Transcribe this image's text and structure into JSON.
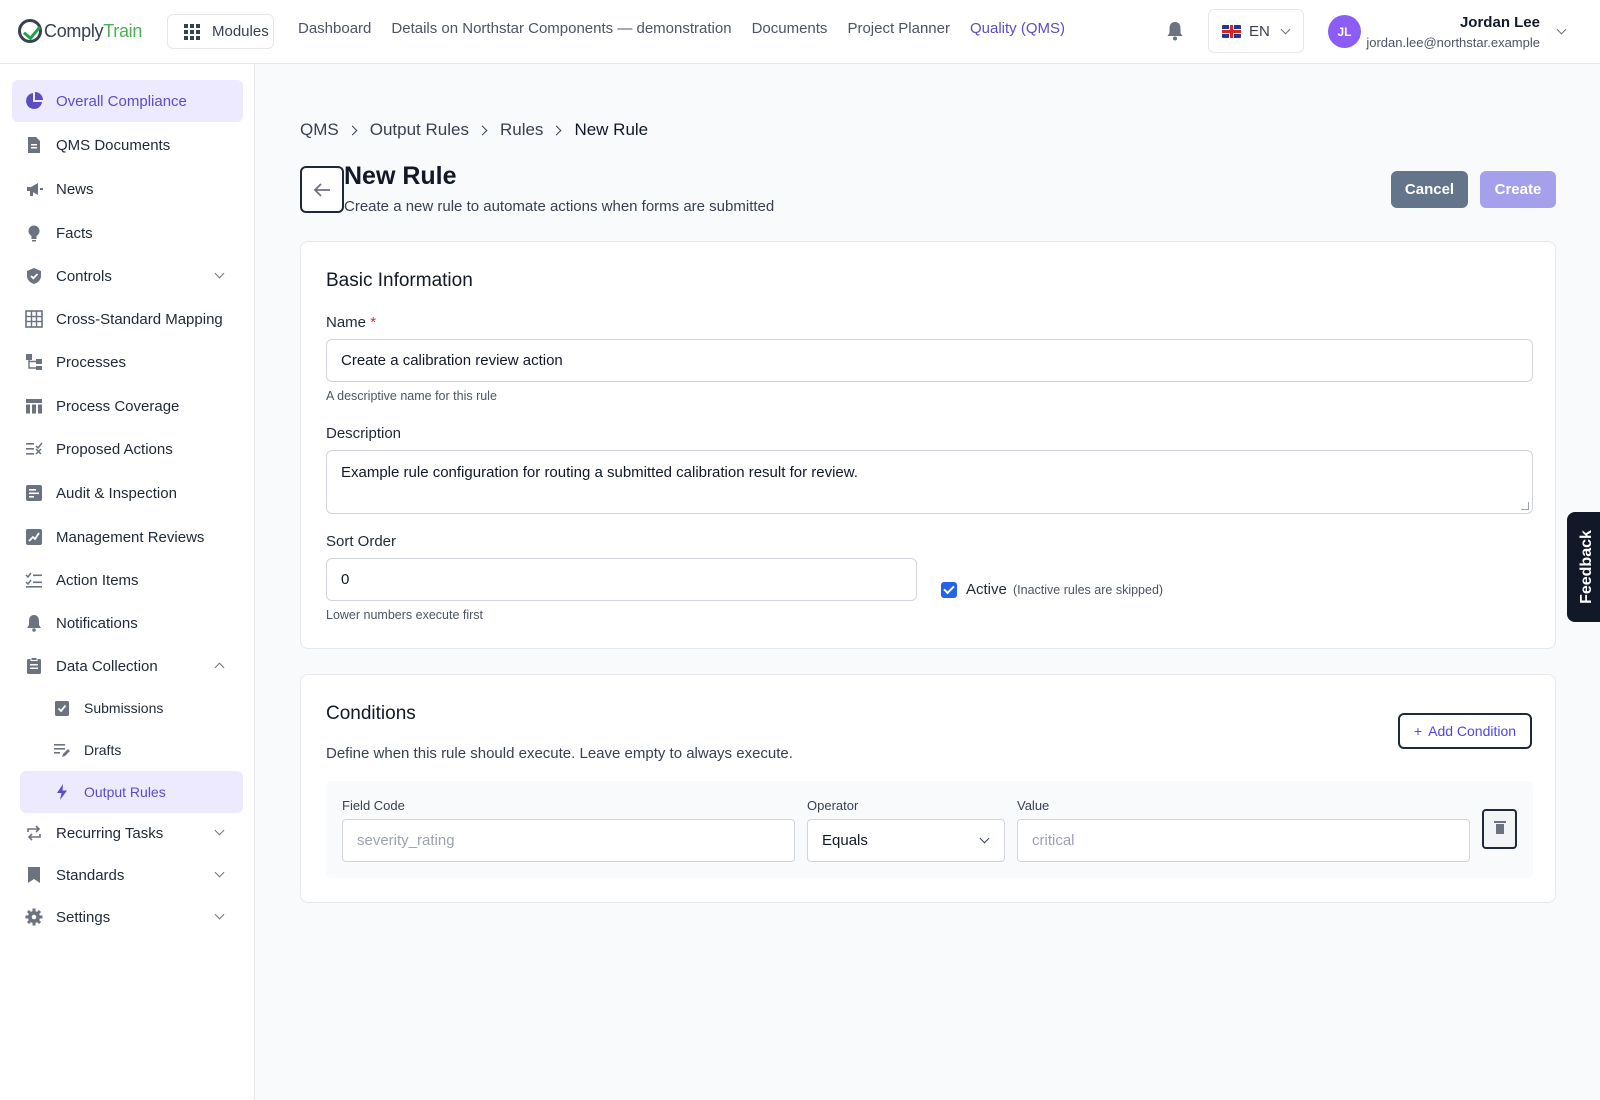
{
  "brand": {
    "part1": "Comply",
    "part2": "Train"
  },
  "topbar": {
    "modules_label": "Modules",
    "nav": [
      "Dashboard",
      "Details on Northstar Components — demonstration",
      "Documents",
      "Project Planner",
      "Quality (QMS)"
    ],
    "active_nav": "Quality (QMS)",
    "language": "EN",
    "user": {
      "initials": "JL",
      "name": "Jordan Lee",
      "email": "jordan.lee@northstar.example"
    }
  },
  "sidebar": {
    "items": [
      {
        "label": "Overall Compliance",
        "icon": "pie-chart-icon",
        "active": true
      },
      {
        "label": "QMS Documents",
        "icon": "document-icon"
      },
      {
        "label": "News",
        "icon": "megaphone-icon"
      },
      {
        "label": "Facts",
        "icon": "lightbulb-icon"
      },
      {
        "label": "Controls",
        "icon": "shield-check-icon",
        "expandable": true
      },
      {
        "label": "Cross-Standard Mapping",
        "icon": "table-icon"
      },
      {
        "label": "Processes",
        "icon": "flow-icon"
      },
      {
        "label": "Process Coverage",
        "icon": "columns-icon"
      },
      {
        "label": "Proposed Actions",
        "icon": "list-check-icon"
      },
      {
        "label": "Audit & Inspection",
        "icon": "audit-icon"
      },
      {
        "label": "Management Reviews",
        "icon": "chart-review-icon"
      },
      {
        "label": "Action Items",
        "icon": "checklist-icon"
      },
      {
        "label": "Notifications",
        "icon": "bell-icon"
      },
      {
        "label": "Data Collection",
        "icon": "clipboard-icon",
        "expanded": true
      },
      {
        "label": "Submissions",
        "icon": "clipboard-check-icon",
        "sub": true
      },
      {
        "label": "Drafts",
        "icon": "draft-icon",
        "sub": true
      },
      {
        "label": "Output Rules",
        "icon": "lightning-icon",
        "sub": true,
        "active": true
      },
      {
        "label": "Recurring Tasks",
        "icon": "repeat-icon",
        "expandable": true
      },
      {
        "label": "Standards",
        "icon": "bookmark-icon",
        "expandable": true
      },
      {
        "label": "Settings",
        "icon": "gear-icon",
        "expandable": true
      }
    ]
  },
  "breadcrumb": [
    "QMS",
    "Output Rules",
    "Rules",
    "New Rule"
  ],
  "page": {
    "title": "New Rule",
    "subtitle": "Create a new rule to automate actions when forms are submitted",
    "cancel_label": "Cancel",
    "create_label": "Create"
  },
  "basic_info": {
    "title": "Basic Information",
    "name_label": "Name",
    "name_required_mark": "*",
    "name_value": "Create a calibration review action",
    "name_hint": "A descriptive name for this rule",
    "description_label": "Description",
    "description_value": "Example rule configuration for routing a submitted calibration result for review.",
    "sort_label": "Sort Order",
    "sort_value": "0",
    "sort_hint": "Lower numbers execute first",
    "active_label": "Active",
    "active_checked": true,
    "active_note": "(Inactive rules are skipped)"
  },
  "conditions": {
    "title": "Conditions",
    "add_label": "Add Condition",
    "description": "Define when this rule should execute. Leave empty to always execute.",
    "field_code_label": "Field Code",
    "field_code_placeholder": "severity_rating",
    "operator_label": "Operator",
    "operator_value": "Equals",
    "value_label": "Value",
    "value_placeholder": "critical"
  },
  "feedback_label": "Feedback",
  "colors": {
    "accent": "#5b4ec4",
    "active_bg": "#ede9fe",
    "cancel": "#64748b",
    "create": "#a5a0ec",
    "brand_green": "#4caf50"
  }
}
